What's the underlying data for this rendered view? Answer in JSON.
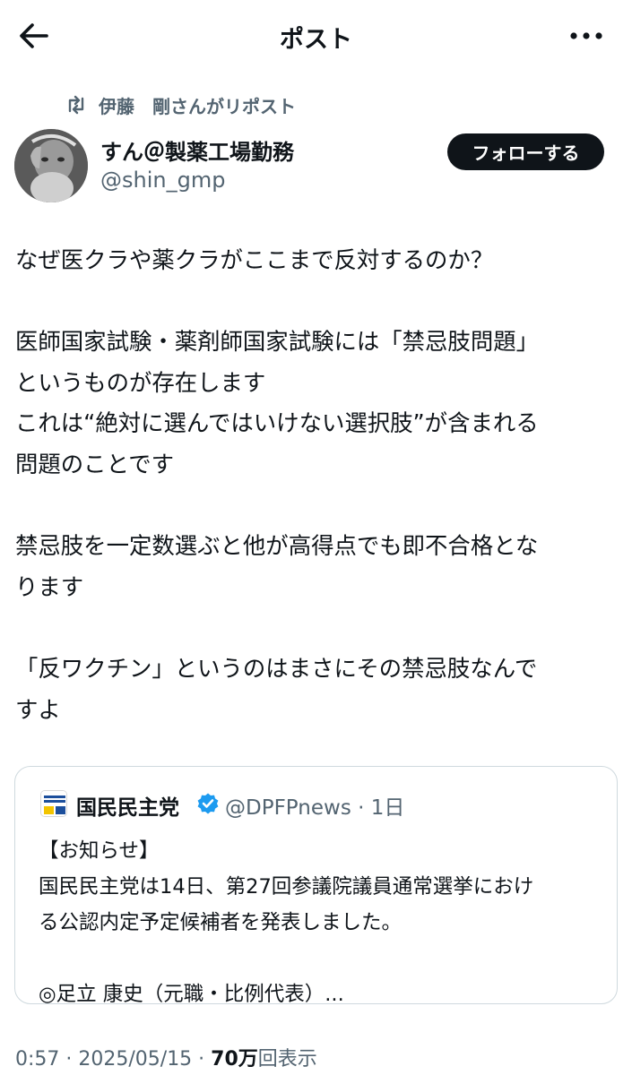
{
  "header": {
    "title": "ポスト",
    "back_icon": "arrow-left-icon",
    "more_icon": "more-horizontal-icon"
  },
  "repost": {
    "icon": "repost-icon",
    "label": "伊藤　剛さんがリポスト"
  },
  "author": {
    "name": "すん＠製薬工場勤務",
    "handle": "@shin_gmp",
    "follow_label": "フォローする"
  },
  "post": {
    "lines": [
      "なぜ医クラや薬クラがここまで反対するのか？",
      "",
      "医師国家試験・薬剤師国家試験には「禁忌肢問題」",
      "というものが存在します",
      "これは“絶対に選んではいけない選択肢”が含まれる",
      "問題のことです",
      "",
      "禁忌肢を一定数選ぶと他が高得点でも即不合格とな",
      "ります",
      "",
      "「反ワクチン」というのはまさにその禁忌肢なんで",
      "すよ"
    ]
  },
  "quote": {
    "name": "国民民主党",
    "handle_time": "@DPFPnews · 1日",
    "lines": [
      "【お知らせ】",
      "国民民主党は14日、第27回参議院議員通常選挙におけ",
      "る公認内定予定候補者を発表しました。",
      "",
      "◎足立 康史（元職・比例代表）..."
    ]
  },
  "meta": {
    "time_date": "0:57 · 2025/05/15 · ",
    "views_count": "70万",
    "views_label": "回表示"
  },
  "colors": {
    "text": "#0f1419",
    "secondary": "#536471",
    "border": "#cfd9de",
    "verified": "#1d9bf0"
  }
}
